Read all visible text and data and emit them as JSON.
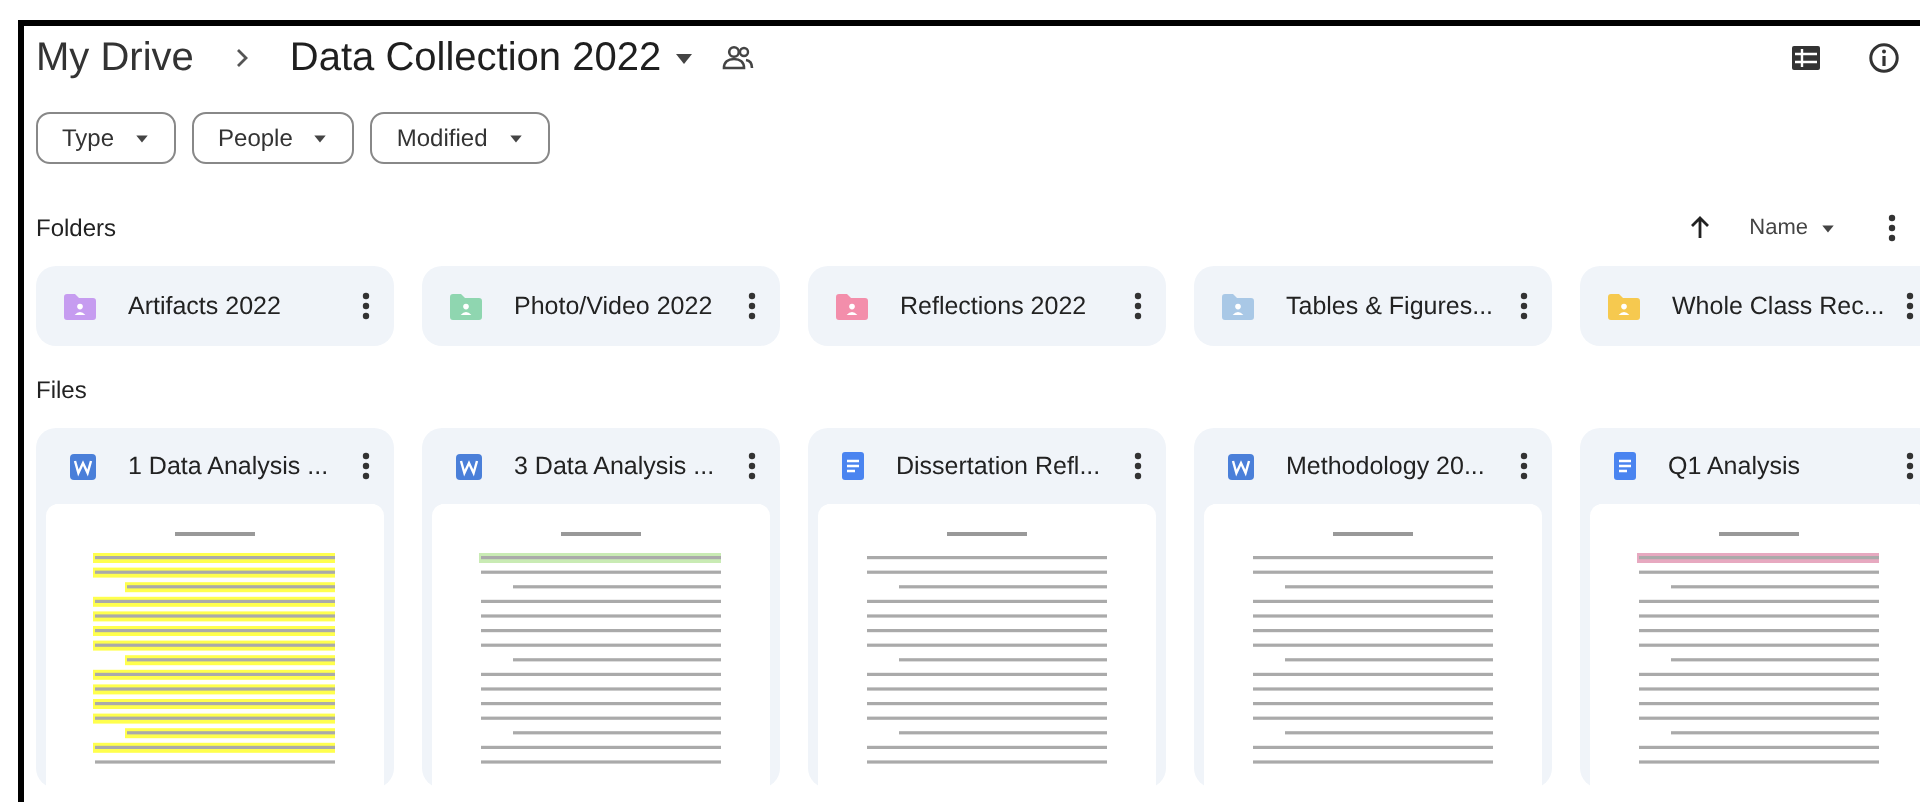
{
  "breadcrumb": [
    {
      "label": "My Drive",
      "kind": "link"
    },
    {
      "label": "Data Collection 2022",
      "kind": "current"
    }
  ],
  "filters": [
    "Type",
    "People",
    "Modified"
  ],
  "folders_section": {
    "label": "Folders",
    "sort": "Name"
  },
  "folders": [
    {
      "name": "Artifacts 2022",
      "color": "#c69cf0"
    },
    {
      "name": "Photo/Video 2022",
      "color": "#8fd6b0"
    },
    {
      "name": "Reflections 2022",
      "color": "#f38eab"
    },
    {
      "name": "Tables & Figures...",
      "color": "#a9c8e6"
    },
    {
      "name": "Whole Class Rec...",
      "color": "#f6c94f"
    }
  ],
  "files_section": {
    "label": "Files"
  },
  "files": [
    {
      "name": "1 Data Analysis ...",
      "kind": "word"
    },
    {
      "name": "3 Data Analysis ...",
      "kind": "word"
    },
    {
      "name": "Dissertation Refl...",
      "kind": "doc"
    },
    {
      "name": "Methodology 20...",
      "kind": "word"
    },
    {
      "name": "Q1 Analysis",
      "kind": "doc"
    }
  ]
}
